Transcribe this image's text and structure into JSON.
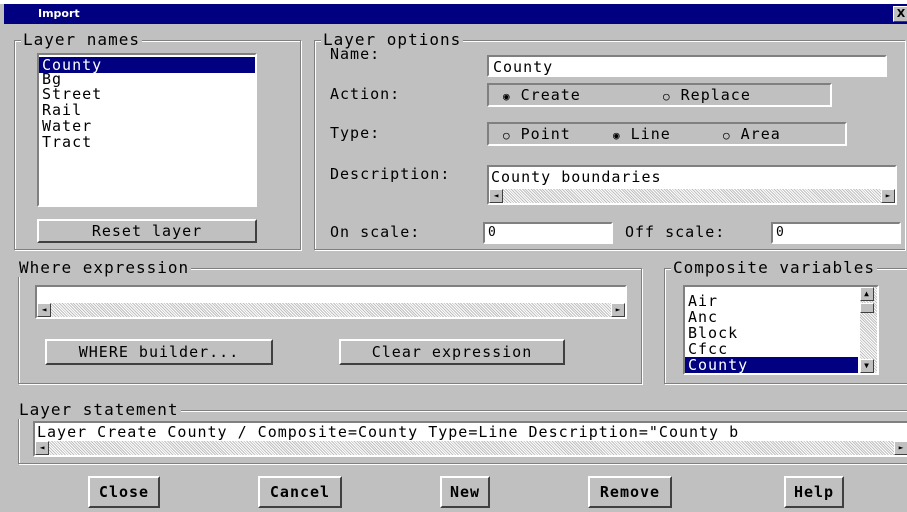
{
  "window": {
    "title": "Import",
    "close_glyph": "X"
  },
  "layer_names": {
    "group_label": "Layer names",
    "items": [
      "County",
      "Bg",
      "Street",
      "Rail",
      "Water",
      "Tract"
    ],
    "selected": "County",
    "reset_button": "Reset layer"
  },
  "layer_options": {
    "group_label": "Layer options",
    "name_label": "Name:",
    "name_value": "County",
    "action_label": "Action:",
    "action_options": [
      "Create",
      "Replace"
    ],
    "action_selected": "Create",
    "type_label": "Type:",
    "type_options": [
      "Point",
      "Line",
      "Area"
    ],
    "type_selected": "Line",
    "description_label": "Description:",
    "description_value": "County boundaries",
    "on_scale_label": "On scale:",
    "on_scale_value": "0",
    "off_scale_label": "Off scale:",
    "off_scale_value": "0"
  },
  "where_expression": {
    "group_label": "Where expression",
    "value": "",
    "builder_button": "WHERE builder...",
    "clear_button": "Clear expression"
  },
  "composite_variables": {
    "group_label": "Composite variables",
    "items": [
      "Air",
      "Anc",
      "Block",
      "Cfcc",
      "County"
    ],
    "selected": "County"
  },
  "layer_statement": {
    "group_label": "Layer statement",
    "value": "Layer Create County / Composite=County Type=Line Description=\"County b"
  },
  "buttons": {
    "close": "Close",
    "cancel": "Cancel",
    "new": "New",
    "remove": "Remove",
    "help": "Help"
  },
  "icons": {
    "radio_on": "◉",
    "radio_off": "○",
    "arrow_left": "◄",
    "arrow_right": "►",
    "arrow_up": "▲",
    "arrow_down": "▼"
  },
  "colors": {
    "title_bar": "#000080",
    "selection": "#000080",
    "face": "#c0c0c0"
  }
}
